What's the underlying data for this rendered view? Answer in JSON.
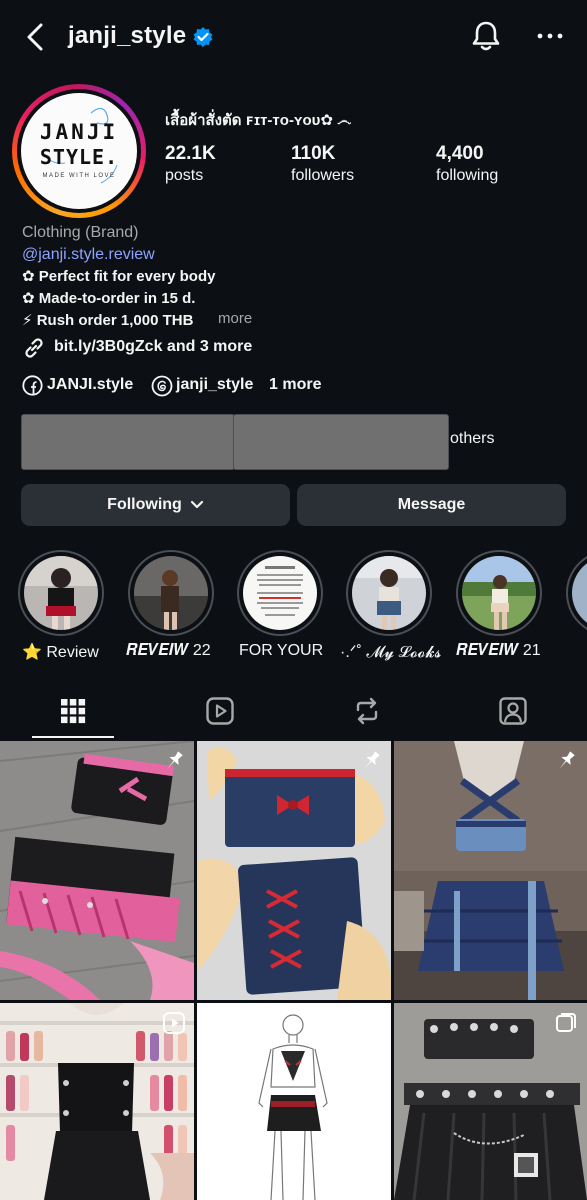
{
  "header": {
    "username": "janji_style",
    "icons": [
      "back-arrow-icon",
      "verified-badge-icon",
      "bell-icon",
      "more-dots-icon"
    ]
  },
  "profile": {
    "avatar_logo_line1": "JANJI",
    "avatar_logo_line2": "STYLE.",
    "avatar_logo_line3": "MADE WITH LOVE",
    "display_name": "เสื้อผ้าสั่งตัด ꜰɪᴛ-ᴛᴏ-ʏᴏᴜ✿ ෴",
    "stats": [
      {
        "num": "22.1K",
        "label": "posts"
      },
      {
        "num": "110K",
        "label": "followers"
      },
      {
        "num": "4,400",
        "label": "following"
      }
    ],
    "category": "Clothing (Brand)",
    "mention": "@janji.style.review",
    "bio": [
      "✿ Perfect fit for every body",
      "✿ Made-to-order in 15 d.",
      "⚡ Rush order 1,000 THB"
    ],
    "bio_more": "more",
    "link_text": "bit.ly/3B0gZck and 3 more",
    "facebook": "JANJI.style",
    "threads": "janji_style",
    "social_more": "1 more",
    "mutuals_text": "others"
  },
  "buttons": {
    "following": "Following",
    "message": "Message"
  },
  "highlights": [
    {
      "label": "⭐ Review"
    },
    {
      "label": "𝑹𝑬𝑽𝑬𝑰𝑾 22"
    },
    {
      "label": "FOR YOUR"
    },
    {
      "label": "·.ᐟ˚ 𝓜𝔂 𝓛𝓸𝓸𝓴𝓼"
    },
    {
      "label": "𝑹𝑬𝑽𝑬𝑰𝑾 21"
    }
  ],
  "tabs": [
    "grid-icon",
    "reels-icon",
    "reposts-icon",
    "tagged-icon"
  ],
  "colors": {
    "background": "#0c1014",
    "button": "#2b3036",
    "link": "#8ea2ff",
    "verified": "#0095f6",
    "secondary_text": "#a8a8a8"
  }
}
